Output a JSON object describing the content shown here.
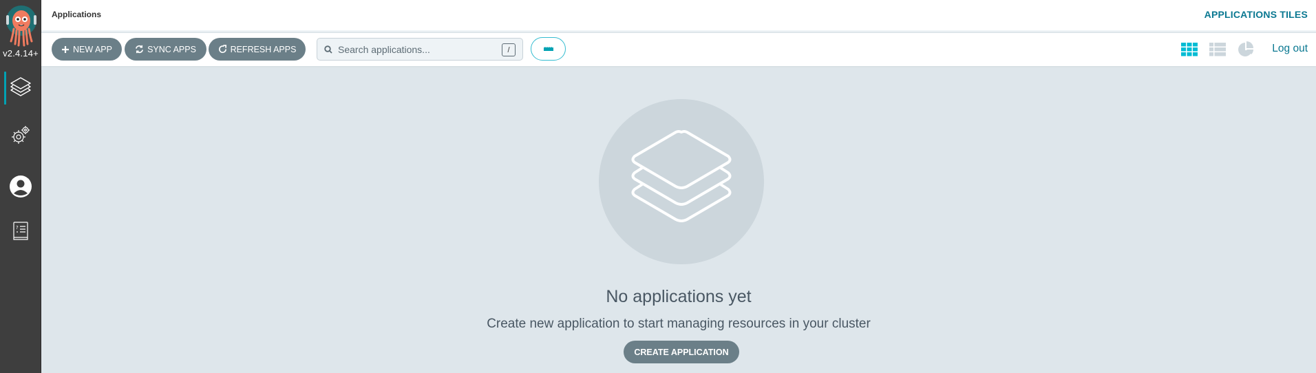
{
  "app": {
    "version": "v2.4.14+",
    "logo": "argo-octopus-logo"
  },
  "sidebar": {
    "items": [
      {
        "name": "applications",
        "icon": "layers-icon",
        "active": true
      },
      {
        "name": "settings",
        "icon": "gears-icon",
        "active": false
      },
      {
        "name": "user-info",
        "icon": "user-circle-icon",
        "active": false
      },
      {
        "name": "documentation",
        "icon": "help-book-icon",
        "active": false
      }
    ]
  },
  "header": {
    "breadcrumb": "Applications",
    "title": "APPLICATIONS TILES"
  },
  "toolbar": {
    "new_app_label": "NEW APP",
    "sync_apps_label": "SYNC APPS",
    "refresh_apps_label": "REFRESH APPS",
    "search_placeholder": "Search applications...",
    "search_value": "",
    "search_shortcut": "/",
    "filter_icon": "ruler-icon",
    "views": [
      {
        "name": "tiles",
        "icon": "grid-icon",
        "active": true
      },
      {
        "name": "list",
        "icon": "list-icon",
        "active": false
      },
      {
        "name": "summary",
        "icon": "pie-chart-icon",
        "active": false
      }
    ],
    "logout_label": "Log out"
  },
  "empty_state": {
    "icon": "layers-icon",
    "title": "No applications yet",
    "subtitle": "Create new application to start managing resources in your cluster",
    "button_label": "CREATE APPLICATION"
  },
  "colors": {
    "accent": "#00a2b3",
    "link": "#0a7891",
    "button": "#6b7f88",
    "sidebar": "#3e3e3e",
    "background": "#dee6eb",
    "active_view": "#00bcd4",
    "inactive_view": "#ccd6dc"
  }
}
